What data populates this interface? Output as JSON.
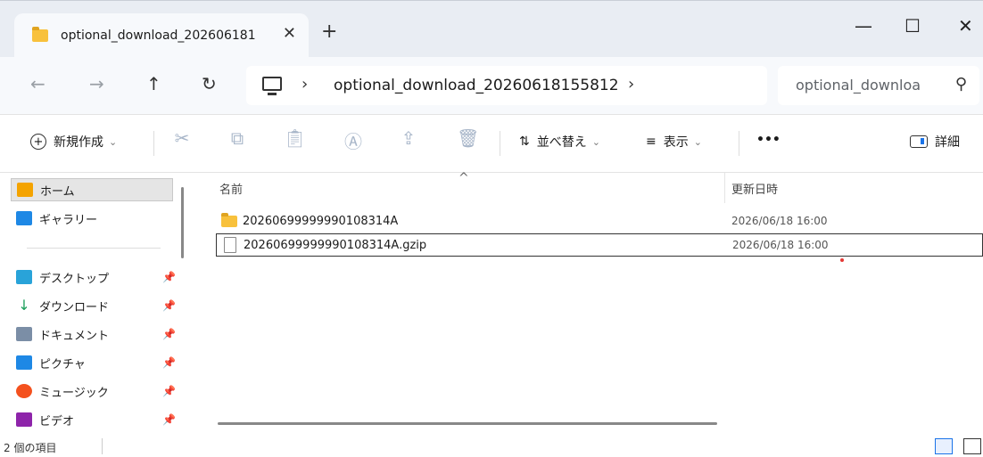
{
  "window": {
    "tab_title": "optional_download_202606181",
    "tab_close": "✕",
    "new_tab": "+",
    "minimize": "—",
    "maximize": "☐",
    "close": "✕"
  },
  "nav": {
    "back": "←",
    "forward": "→",
    "up": "↑",
    "refresh": "↻",
    "breadcrumb_sep": "›",
    "breadcrumb": "optional_download_20260618155812",
    "search_placeholder": "optional_downloa",
    "search_icon": "⚲"
  },
  "commandbar": {
    "new_label": "新規作成",
    "sort_label": "並べ替え",
    "view_label": "表示",
    "more_label": "•••",
    "details_label": "詳細",
    "chevron": "⌄"
  },
  "sidebar": {
    "home": "ホーム",
    "gallery": "ギャラリー",
    "items": [
      {
        "label": "デスクトップ",
        "color": "#29a3d9"
      },
      {
        "label": "ダウンロード",
        "color": "#1a9e5a"
      },
      {
        "label": "ドキュメント",
        "color": "#7b8ea6"
      },
      {
        "label": "ピクチャ",
        "color": "#1e88e5"
      },
      {
        "label": "ミュージック",
        "color": "#f4511e"
      },
      {
        "label": "ビデオ",
        "color": "#8e24aa"
      }
    ],
    "pin": "📌"
  },
  "filelist": {
    "col_name": "名前",
    "col_modified": "更新日時",
    "rows": [
      {
        "name": "20260699999990108314A",
        "modified": "2026/06/18 16:00",
        "type": "folder"
      },
      {
        "name": "20260699999990108314A.gzip",
        "modified": "2026/06/18 16:00",
        "type": "file"
      }
    ]
  },
  "status": {
    "item_count": "2 個の項目"
  }
}
